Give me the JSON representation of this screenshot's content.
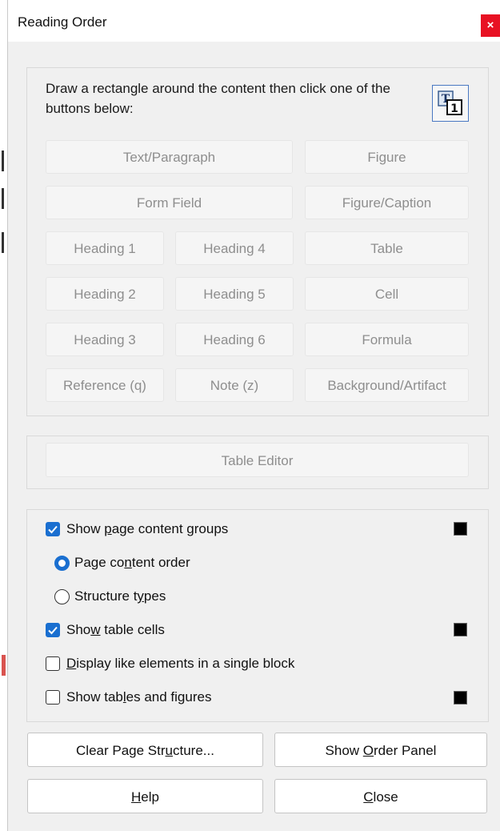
{
  "window": {
    "title": "Reading Order",
    "close_glyph": "×"
  },
  "instruction": "Draw a rectangle around the content then click one of the buttons below:",
  "tag_buttons": {
    "text_paragraph": "Text/Paragraph",
    "figure": "Figure",
    "form_field": "Form Field",
    "figure_caption": "Figure/Caption",
    "heading1": "Heading 1",
    "heading4": "Heading 4",
    "table": "Table",
    "heading2": "Heading 2",
    "heading5": "Heading 5",
    "cell": "Cell",
    "heading3": "Heading 3",
    "heading6": "Heading 6",
    "formula": "Formula",
    "reference": "Reference (q)",
    "note": "Note (z)",
    "background": "Background/Artifact"
  },
  "table_editor": "Table Editor",
  "options": {
    "show_groups": {
      "pre": "Show ",
      "u": "p",
      "post": "age content groups",
      "checked": true
    },
    "page_content_order": {
      "pre": "Page co",
      "u": "n",
      "post": "tent order",
      "selected": true
    },
    "structure_types": {
      "pre": "Structure t",
      "u": "y",
      "post": "pes",
      "selected": false
    },
    "show_table_cells": {
      "pre": "Sho",
      "u": "w",
      "post": " table cells",
      "checked": true
    },
    "display_like": {
      "pre": "",
      "u": "D",
      "post": "isplay like elements in a single block",
      "checked": false
    },
    "show_tables_figures": {
      "pre": "Show tab",
      "u": "l",
      "post": "es and figures",
      "checked": false
    }
  },
  "check_glyph": "✓",
  "swatch_color": "#000000",
  "bottom_buttons": {
    "clear": {
      "pre": "Clear Page Str",
      "u": "u",
      "post": "cture..."
    },
    "show_order": {
      "pre": "Show ",
      "u": "O",
      "post": "rder Panel"
    },
    "help": {
      "pre": "",
      "u": "H",
      "post": "elp"
    },
    "close": {
      "pre": "",
      "u": "C",
      "post": "lose"
    }
  },
  "icon_glyphs": {
    "t": "T",
    "one": "1"
  }
}
